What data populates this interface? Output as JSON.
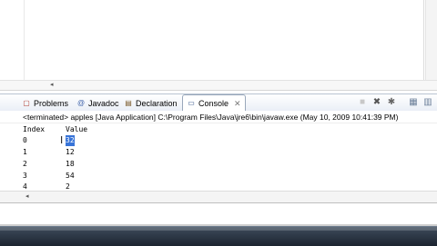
{
  "editor": {
    "scroll_left_arrow": "◂"
  },
  "tabs": [
    {
      "label": "Problems",
      "icon": "problems-icon",
      "glyph": "▢"
    },
    {
      "label": "Javadoc",
      "icon": "javadoc-icon",
      "glyph": "@"
    },
    {
      "label": "Declaration",
      "icon": "declaration-icon",
      "glyph": "▤"
    },
    {
      "label": "Console",
      "icon": "console-icon",
      "glyph": "▭",
      "close": "✕",
      "active": true
    }
  ],
  "toolbar": {
    "terminate": "■",
    "remove_launch": "✖",
    "remove_all": "✱",
    "clear": "▦",
    "scroll_lock": "▥"
  },
  "status_line": "<terminated> apples [Java Application] C:\\Program Files\\Java\\jre6\\bin\\javaw.exe (May 10, 2009 10:41:39 PM)",
  "console": {
    "header": {
      "index": "Index",
      "value": "Value"
    },
    "rows": [
      {
        "index": "0",
        "value": "32",
        "selected": true
      },
      {
        "index": "1",
        "value": "12"
      },
      {
        "index": "2",
        "value": "18"
      },
      {
        "index": "3",
        "value": "54"
      },
      {
        "index": "4",
        "value": "2"
      }
    ],
    "cursor": "I"
  },
  "panel_scroll_arrow": "◂"
}
